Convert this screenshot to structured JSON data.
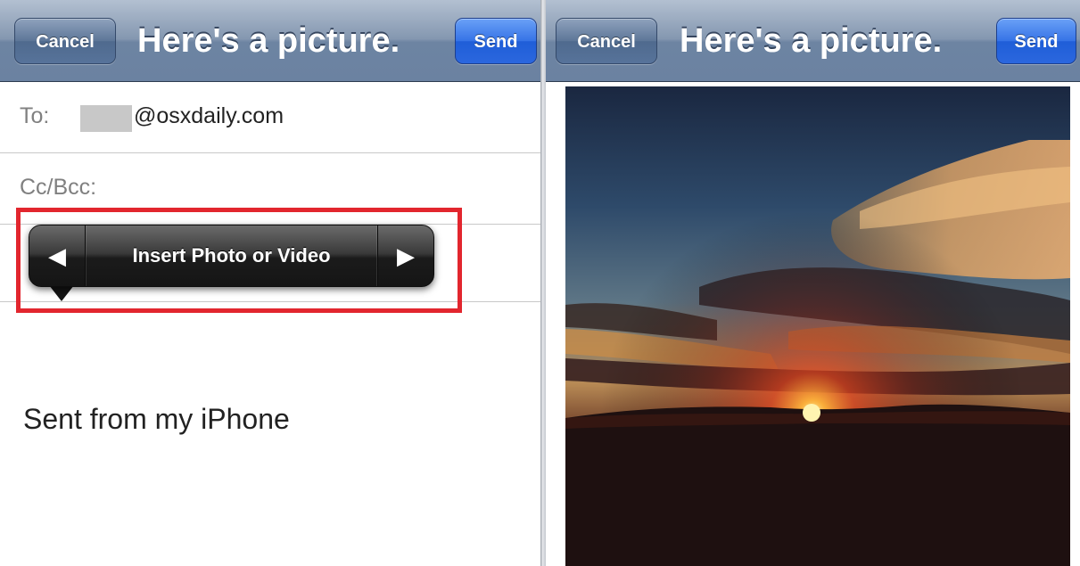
{
  "left_screen": {
    "nav": {
      "cancel_label": "Cancel",
      "title": "Here's a picture.",
      "send_label": "Send"
    },
    "fields": {
      "to_label": "To:",
      "to_value": "@osxdaily.com",
      "cc_bcc_label": "Cc/Bcc:"
    },
    "popover": {
      "prev_arrow": "◀",
      "label": "Insert Photo or Video",
      "next_arrow": "▶"
    },
    "body": {
      "signature": "Sent from my iPhone"
    }
  },
  "right_screen": {
    "nav": {
      "cancel_label": "Cancel",
      "title": "Here's a picture.",
      "send_label": "Send"
    },
    "photo": {
      "subject": "sunset-photo"
    }
  },
  "colors": {
    "nav_bar": "#7f93ae",
    "send_button": "#2b67de",
    "cancel_button": "#57739a",
    "highlight_box": "#e2262e",
    "popover": "#1b1b1b"
  }
}
